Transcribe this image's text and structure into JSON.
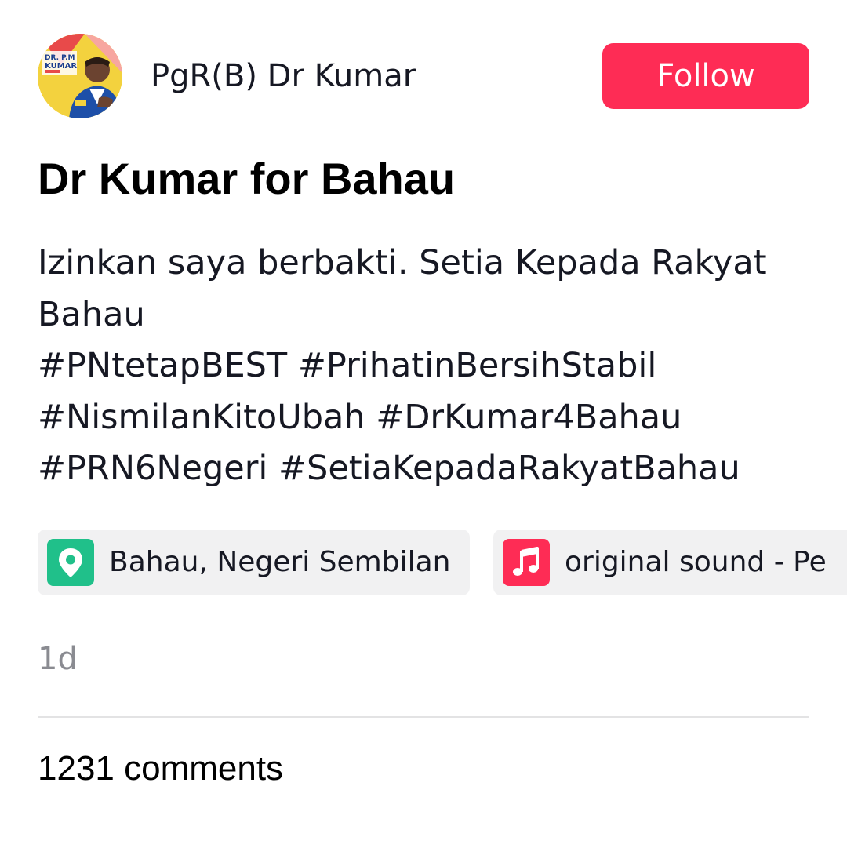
{
  "header": {
    "username": "PgR(B) Dr Kumar",
    "follow_label": "Follow",
    "avatar_badge_text": "DR. P.M KUMAR"
  },
  "post": {
    "title": "Dr Kumar for Bahau",
    "caption_lines": [
      "Izinkan saya berbakti. Setia Kepada Rakyat",
      "Bahau"
    ],
    "hashtag_lines": [
      [
        "#PNtetapBEST",
        "#PrihatinBersihStabil"
      ],
      [
        "#NismilanKitoUbah",
        "#DrKumar4Bahau"
      ],
      [
        "#PRN6Negeri",
        "#SetiaKepadaRakyatBahau"
      ]
    ],
    "location_label": "Bahau, Negeri Sembilan",
    "sound_label": "original sound - Pe",
    "timestamp": "1d",
    "comments_label": "1231 comments"
  },
  "icons": {
    "location": "location-pin-icon",
    "sound": "music-note-icon"
  },
  "colors": {
    "follow_bg": "#fe2c55",
    "location_icon_bg": "#20c08a",
    "sound_icon_bg": "#fe2c55",
    "chip_bg": "#f1f1f2",
    "muted_text": "#8a8b91"
  }
}
